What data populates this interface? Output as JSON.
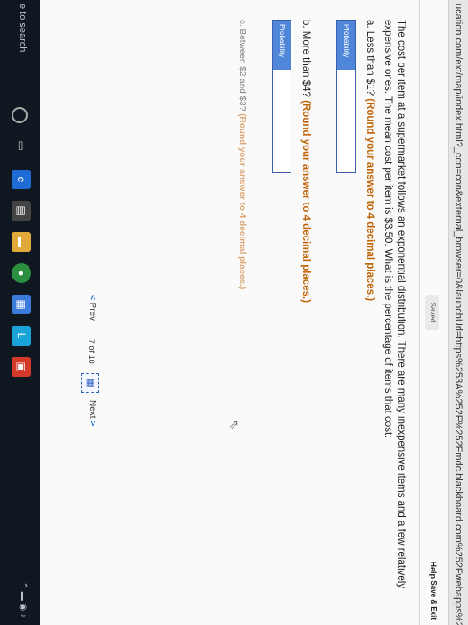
{
  "browser": {
    "url": "ucation.com/ext/map/index.html?_con=con&external_browser=0&launchUrl=https%253A%252F%252Fmdc.blackboard.com%252Fwebapps%252"
  },
  "header": {
    "status": "Saved",
    "help": "Help",
    "save_exit": "Save & Exit"
  },
  "question": {
    "text": "The cost per item at a supermarket follows an exponential distribution. There are many inexpensive items and a few relatively expensive ones. The mean cost per item is $3.50. What is the percentage of items that cost:",
    "parts": [
      {
        "prompt": "a. Less than $1?",
        "instruction": "(Round your answer to 4 decimal places.)",
        "field_label": "Probability",
        "value": ""
      },
      {
        "prompt": "b. More than $4?",
        "instruction": "(Round your answer to 4 decimal places.)",
        "field_label": "Probability",
        "value": ""
      },
      {
        "prompt": "c. Between $2 and $3?",
        "instruction": "(Round your answer to 4 decimal places.)"
      }
    ]
  },
  "nav": {
    "prev": "Prev",
    "page_current": "7",
    "page_of": "of",
    "page_total": "10",
    "next": "Next"
  },
  "taskbar": {
    "search": "e to search",
    "icons": [
      "cortana-icon",
      "task-view-icon",
      "edge-icon",
      "store-icon",
      "explorer-icon",
      "chrome-icon",
      "app-icon-1",
      "app-icon-2",
      "app-icon-3"
    ]
  },
  "colors": {
    "accent": "#c0650a",
    "field_label_bg": "#4f86d8",
    "link": "#1a6fd0"
  }
}
